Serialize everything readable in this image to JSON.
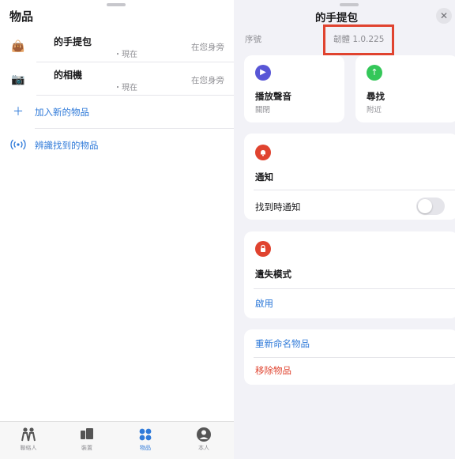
{
  "left": {
    "title": "物品",
    "items": [
      {
        "icon": "handbag-icon",
        "glyph": "👜",
        "name": "的手提包",
        "time": "・現在",
        "where": "在您身旁"
      },
      {
        "icon": "camera-icon",
        "glyph": "📷",
        "name": "的相機",
        "time": "・現在",
        "where": "在您身旁"
      }
    ],
    "actions": {
      "add_label": "加入新的物品",
      "identify_label": "辨識找到的物品"
    }
  },
  "tabs": [
    {
      "label": "聯絡人",
      "icon": "people-icon"
    },
    {
      "label": "裝置",
      "icon": "devices-icon"
    },
    {
      "label": "物品",
      "icon": "items-icon",
      "active": true
    },
    {
      "label": "本人",
      "icon": "person-icon"
    }
  ],
  "sheet": {
    "title": "的手提包",
    "close_glyph": "✕",
    "serial_label": "序號",
    "firmware": "韌體 1.0.225",
    "play_sound": {
      "title": "播放聲音",
      "status": "關閉"
    },
    "find": {
      "title": "尋找",
      "status": "附近"
    },
    "notifications": {
      "title": "通知",
      "notify_when_found": "找到時通知",
      "toggle_on": false
    },
    "lost_mode": {
      "title": "遺失模式",
      "enable": "啟用"
    },
    "rename": "重新命名物品",
    "remove": "移除物品"
  },
  "colors": {
    "accent": "#2f7ad9",
    "play_purple": "#5856d6",
    "find_green": "#34c759",
    "bell_red": "#e0432f",
    "lock_red": "#e0432f",
    "highlight": "#e0432f"
  }
}
